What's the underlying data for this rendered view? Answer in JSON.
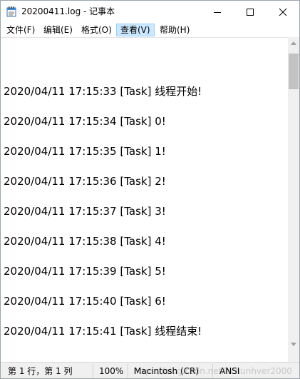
{
  "window": {
    "title": "20200411.log - 记事本"
  },
  "menu": [
    {
      "label": "文件(F)"
    },
    {
      "label": "编辑(E)"
    },
    {
      "label": "格式(O)"
    },
    {
      "label": "查看(V)",
      "active": true
    },
    {
      "label": "帮助(H)"
    }
  ],
  "editor": {
    "lines": [
      "2020/04/11 17:15:33 [Task] 线程开始!",
      "2020/04/11 17:15:34 [Task] 0!",
      "2020/04/11 17:15:35 [Task] 1!",
      "2020/04/11 17:15:36 [Task] 2!",
      "2020/04/11 17:15:37 [Task] 3!",
      "2020/04/11 17:15:38 [Task] 4!",
      "2020/04/11 17:15:39 [Task] 5!",
      "2020/04/11 17:15:40 [Task] 6!",
      "2020/04/11 17:15:41 [Task] 线程结束!"
    ]
  },
  "status": {
    "position": "第 1 行，第 1 列",
    "zoom": "100%",
    "line_ending": "Macintosh (CR)",
    "encoding": "ANSI",
    "watermark": "https://blog.csdn.net/hchunhver2000"
  },
  "colors": {
    "menu_active_bg": "#cce8ff",
    "menu_active_border": "#99d1ff",
    "status_bg": "#f0f0f0",
    "scroll_thumb": "#c2c2c2"
  },
  "icons": {
    "app": "notepad-icon",
    "minimize": "minimize-icon",
    "maximize": "maximize-icon",
    "close": "close-icon"
  }
}
